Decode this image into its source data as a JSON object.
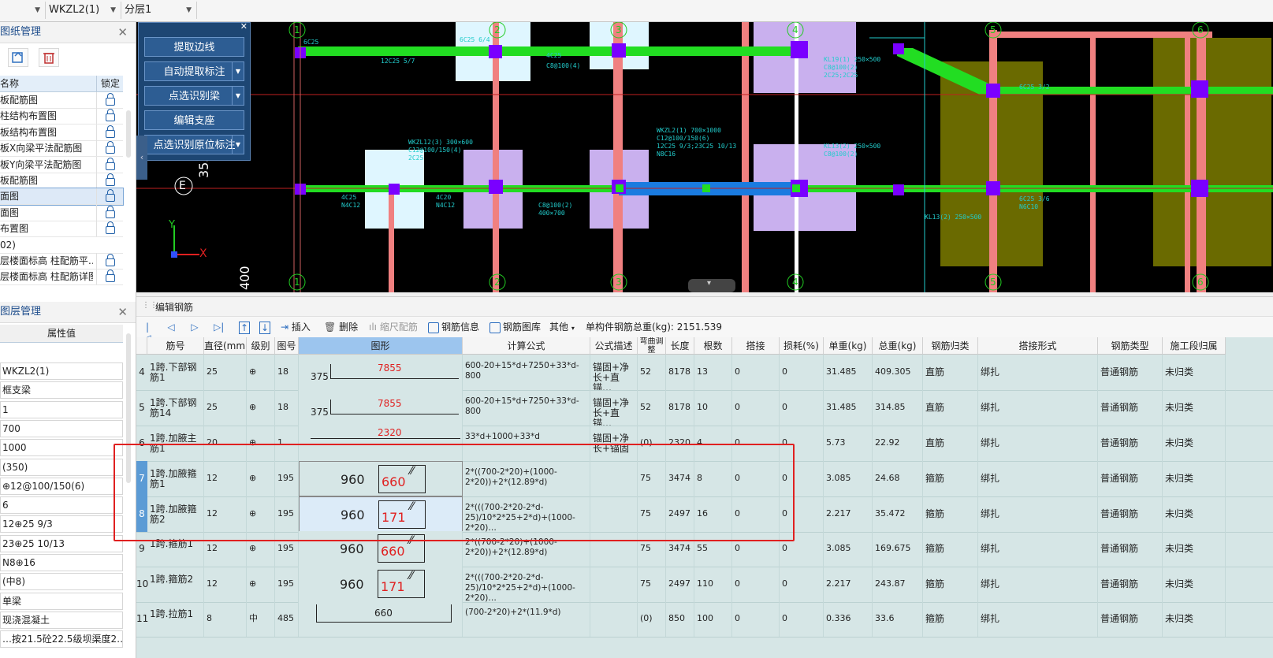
{
  "toolbar": {
    "combo_floor": "",
    "combo_component": "WKZL2(1)",
    "combo_layer": "分层1"
  },
  "drawing_panel": {
    "title": "图纸管理",
    "columns": [
      "名称",
      "锁定"
    ],
    "items": [
      "板配筋图",
      "柱结构布置图",
      "板结构布置图",
      "板X向梁平法配筋图",
      "板Y向梁平法配筋图",
      "板配筋图",
      "面图",
      "面图",
      "布置图",
      "02)",
      "层楼面标高 柱配筋平…",
      "层楼面标高 柱配筋详图"
    ],
    "selected_index": 6
  },
  "layer_panel": {
    "title": "图层管理",
    "header": "属性值",
    "values": [
      "WKZL2(1)",
      "框支梁",
      "1",
      "700",
      "1000",
      "(350)",
      "⊕12@100/150(6)",
      "6",
      "12⊕25 9/3",
      "23⊕25 10/13",
      "N8⊕16",
      "(中8)",
      "单梁",
      "现浇混凝土",
      "…按21.5砼22.5级坝渠度2…"
    ]
  },
  "cad_tools": {
    "buttons": [
      "提取边线",
      "自动提取标注",
      "点选识别梁",
      "编辑支座",
      "点选识别原位标注"
    ],
    "axis_label_E": "E",
    "dim_3530": "3530",
    "dim_400": "400",
    "axis_x": "X",
    "axis_y": "Y",
    "grid_numbers": [
      "1",
      "2",
      "3",
      "4",
      "5",
      "6"
    ]
  },
  "rebar_editor": {
    "title": "编辑钢筋",
    "insert": "插入",
    "delete": "删除",
    "scale": "缩尺配筋",
    "info": "钢筋信息",
    "library": "钢筋图库",
    "other": "其他",
    "total": "单构件钢筋总重(kg): 2151.539"
  },
  "table": {
    "headers": [
      "筋号",
      "直径(mm)",
      "级别",
      "图号",
      "图形",
      "计算公式",
      "公式描述",
      "弯曲调整",
      "长度",
      "根数",
      "搭接",
      "损耗(%)",
      "单重(kg)",
      "总重(kg)",
      "钢筋归类",
      "搭接形式",
      "钢筋类型",
      "施工段归属"
    ],
    "rows": [
      {
        "no": "4",
        "name": "1跨.下部钢筋1",
        "dia": "25",
        "grade": "⊕",
        "fig": "18",
        "shape_a": "375",
        "shape_b": "7855",
        "formula": "600-20+15*d+7250+33*d-800",
        "desc": "锚固+净长+直锚…",
        "bend": "52",
        "len": "8178",
        "count": "13",
        "lap": "0",
        "loss": "0",
        "unit": "31.485",
        "total": "409.305",
        "cat": "直筋",
        "lapform": "绑扎",
        "type": "普通钢筋",
        "stage": "未归类"
      },
      {
        "no": "5",
        "name": "1跨.下部钢筋14",
        "dia": "25",
        "grade": "⊕",
        "fig": "18",
        "shape_a": "375",
        "shape_b": "7855",
        "formula": "600-20+15*d+7250+33*d-800",
        "desc": "锚固+净长+直锚…",
        "bend": "52",
        "len": "8178",
        "count": "10",
        "lap": "0",
        "loss": "0",
        "unit": "31.485",
        "total": "314.85",
        "cat": "直筋",
        "lapform": "绑扎",
        "type": "普通钢筋",
        "stage": "未归类"
      },
      {
        "no": "6",
        "name": "1跨.加腋主筋1",
        "dia": "20",
        "grade": "⊕",
        "fig": "1",
        "shape_a": "",
        "shape_b": "2320",
        "formula": "33*d+1000+33*d",
        "desc": "锚固+净长+锚固",
        "bend": "(0)",
        "len": "2320",
        "count": "4",
        "lap": "0",
        "loss": "0",
        "unit": "5.73",
        "total": "22.92",
        "cat": "直筋",
        "lapform": "绑扎",
        "type": "普通钢筋",
        "stage": "未归类"
      },
      {
        "no": "7",
        "name": "1跨.加腋箍筋1",
        "dia": "12",
        "grade": "⊕",
        "fig": "195",
        "shape_a": "960",
        "shape_b": "660",
        "formula": "2*((700-2*20)+(1000-2*20))+2*(12.89*d)",
        "desc": "",
        "bend": "75",
        "len": "3474",
        "count": "8",
        "lap": "0",
        "loss": "0",
        "unit": "3.085",
        "total": "24.68",
        "cat": "箍筋",
        "lapform": "绑扎",
        "type": "普通钢筋",
        "stage": "未归类"
      },
      {
        "no": "8",
        "name": "1跨.加腋箍筋2",
        "dia": "12",
        "grade": "⊕",
        "fig": "195",
        "shape_a": "960",
        "shape_b": "171",
        "formula": "2*(((700-2*20-2*d-25)/10*2*25+2*d)+(1000-2*20)…",
        "desc": "",
        "bend": "75",
        "len": "2497",
        "count": "16",
        "lap": "0",
        "loss": "0",
        "unit": "2.217",
        "total": "35.472",
        "cat": "箍筋",
        "lapform": "绑扎",
        "type": "普通钢筋",
        "stage": "未归类"
      },
      {
        "no": "9",
        "name": "1跨.箍筋1",
        "dia": "12",
        "grade": "⊕",
        "fig": "195",
        "shape_a": "960",
        "shape_b": "660",
        "formula": "2*((700-2*20)+(1000-2*20))+2*(12.89*d)",
        "desc": "",
        "bend": "75",
        "len": "3474",
        "count": "55",
        "lap": "0",
        "loss": "0",
        "unit": "3.085",
        "total": "169.675",
        "cat": "箍筋",
        "lapform": "绑扎",
        "type": "普通钢筋",
        "stage": "未归类"
      },
      {
        "no": "10",
        "name": "1跨.箍筋2",
        "dia": "12",
        "grade": "⊕",
        "fig": "195",
        "shape_a": "960",
        "shape_b": "171",
        "formula": "2*(((700-2*20-2*d-25)/10*2*25+2*d)+(1000-2*20)…",
        "desc": "",
        "bend": "75",
        "len": "2497",
        "count": "110",
        "lap": "0",
        "loss": "0",
        "unit": "2.217",
        "total": "243.87",
        "cat": "箍筋",
        "lapform": "绑扎",
        "type": "普通钢筋",
        "stage": "未归类"
      },
      {
        "no": "11",
        "name": "1跨.拉筋1",
        "dia": "8",
        "grade": "中",
        "fig": "485",
        "shape_a": "",
        "shape_b": "660",
        "formula": "(700-2*20)+2*(11.9*d)",
        "desc": "",
        "bend": "(0)",
        "len": "850",
        "count": "100",
        "lap": "0",
        "loss": "0",
        "unit": "0.336",
        "total": "33.6",
        "cat": "箍筋",
        "lapform": "绑扎",
        "type": "普通钢筋",
        "stage": "未归类"
      }
    ]
  },
  "colors": {
    "accent": "#2e6fc0",
    "highlight_box": "#e02020",
    "beam_green": "#22dd22",
    "column_purple": "#7a00ff"
  }
}
